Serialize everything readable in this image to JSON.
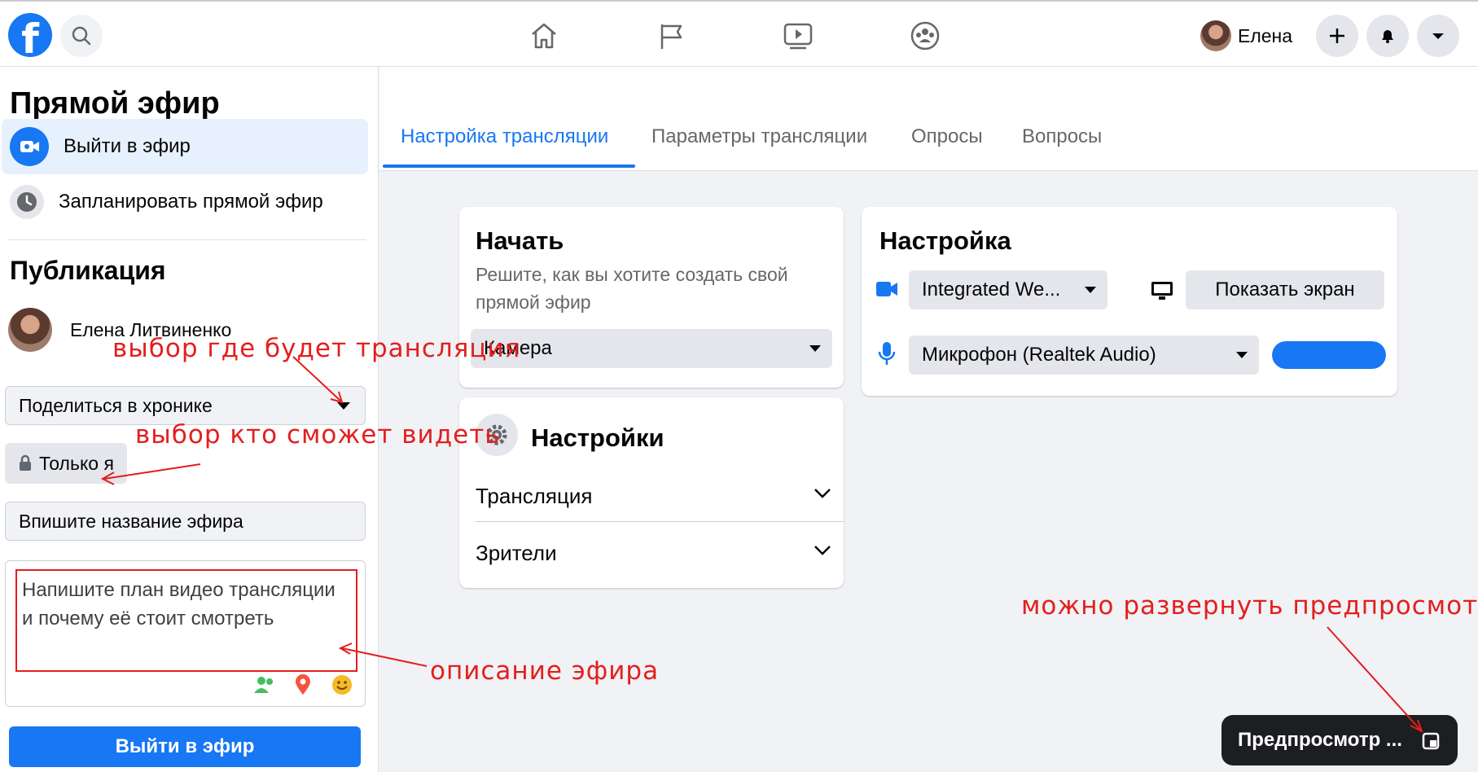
{
  "header": {
    "logo": "f",
    "profile_name": "Елена"
  },
  "sidebar": {
    "title": "Прямой эфир",
    "items": [
      {
        "label": "Выйти в эфир",
        "icon": "live-camera-icon",
        "active": true
      },
      {
        "label": "Запланировать прямой эфир",
        "icon": "clock-icon",
        "active": false
      }
    ],
    "publication_title": "Публикация",
    "author_name": "Елена Литвиненко",
    "share_target": "Поделиться в хронике",
    "privacy": "Только я",
    "title_placeholder": "Впишите название эфира",
    "description": "Напишите план видео трансляции и почему её стоит смотреть",
    "go_live_button": "Выйти в эфир"
  },
  "tabs": [
    {
      "label": "Настройка трансляции",
      "active": true
    },
    {
      "label": "Параметры трансляции",
      "active": false
    },
    {
      "label": "Опросы",
      "active": false
    },
    {
      "label": "Вопросы",
      "active": false
    }
  ],
  "start_card": {
    "title": "Начать",
    "subtitle": "Решите, как вы хотите создать свой прямой эфир",
    "source": "Камера"
  },
  "settings_card": {
    "title": "Настройки",
    "rows": [
      "Трансляция",
      "Зрители"
    ]
  },
  "setup_card": {
    "title": "Настройка",
    "camera": "Integrated We...",
    "share_screen": "Показать экран",
    "microphone": "Микрофон (Realtek Audio)",
    "mic_level": 1.0
  },
  "preview": {
    "label": "Предпросмотр ..."
  },
  "annotations": {
    "where": "выбор где будет трансляция",
    "who": "выбор кто сможет видеть",
    "description": "описание эфира",
    "preview": "можно развернуть предпросмотр"
  },
  "colors": {
    "accent": "#1877f2",
    "annotation": "#e41e1e"
  }
}
